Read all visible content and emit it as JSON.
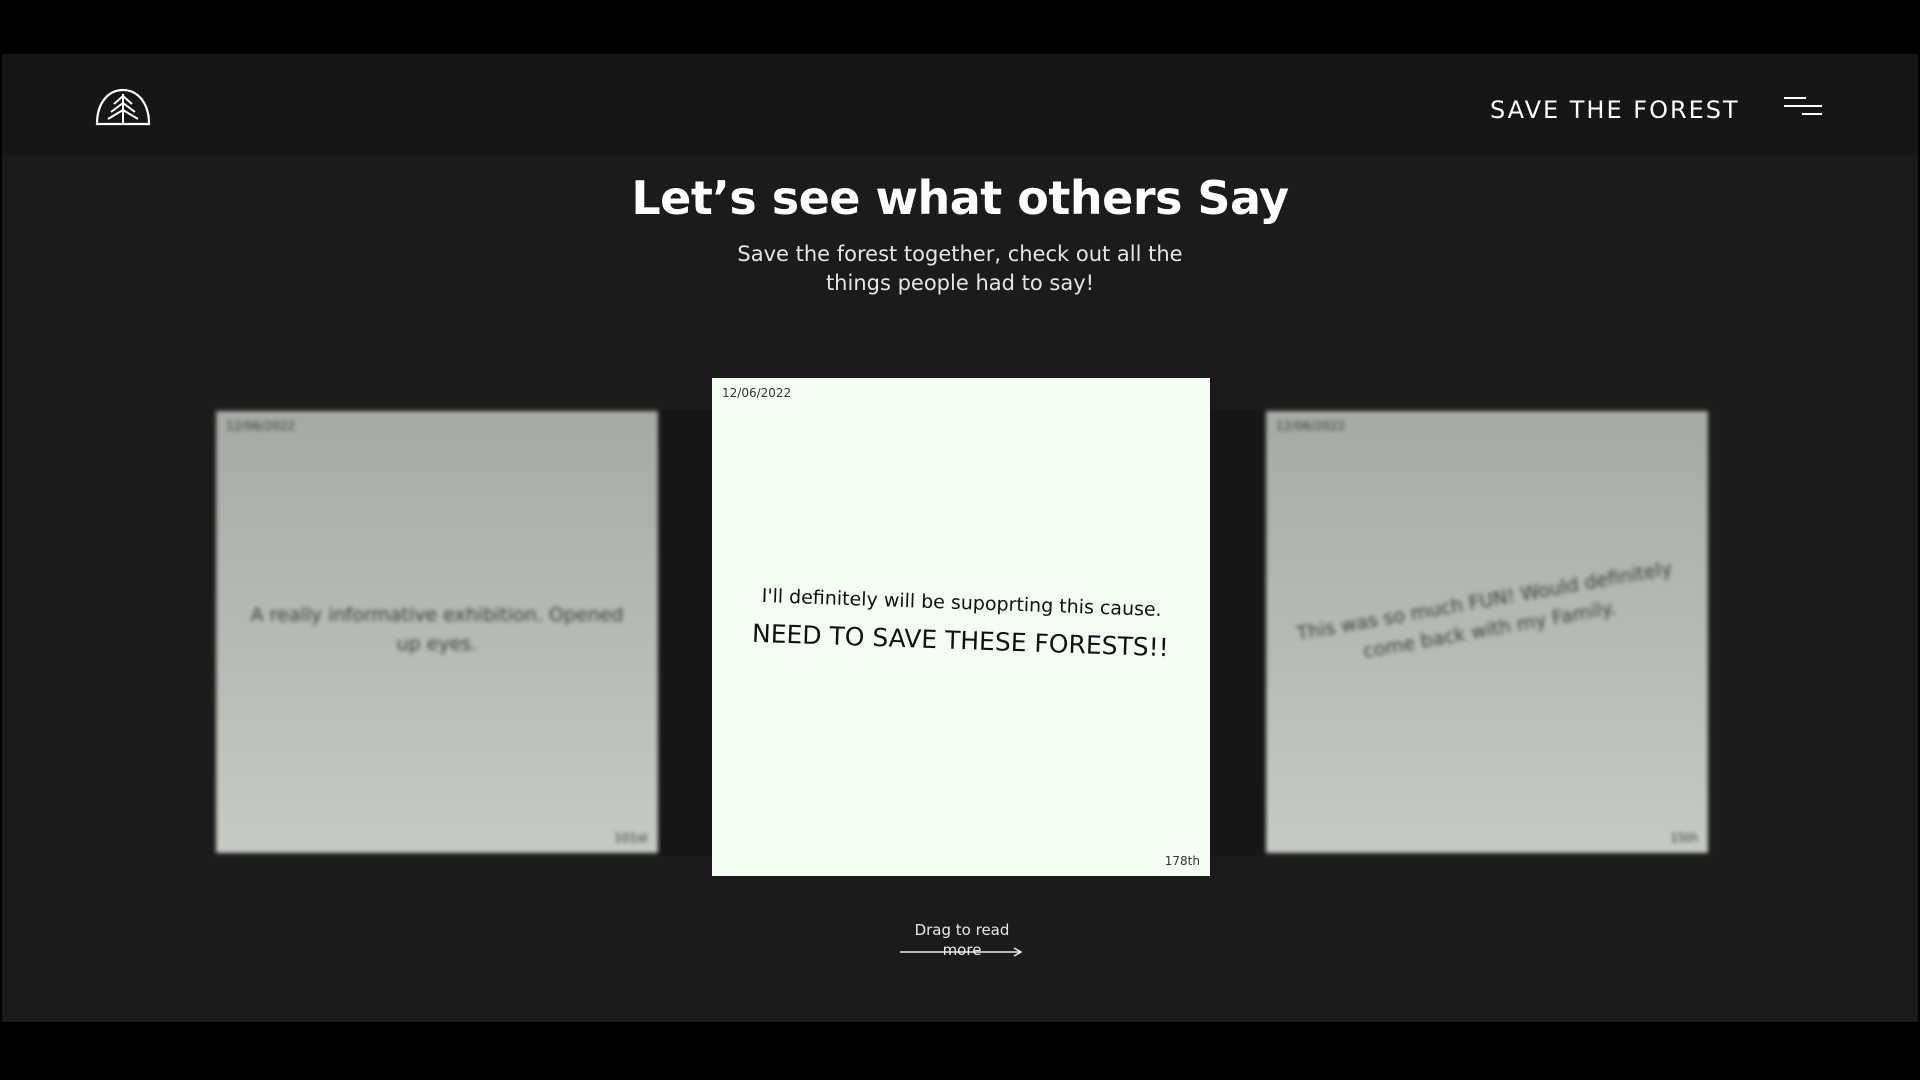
{
  "header": {
    "brand": "SAVE THE FOREST",
    "logo_icon": "tree-dome-icon",
    "menu_icon": "hamburger-menu-icon"
  },
  "section": {
    "title": "Let’s see what others Say",
    "subtitle": "Save the forest together, check out all the things people had to say!"
  },
  "cards": [
    {
      "date": "12/06/2022",
      "message": "A really informative exhibition. Opened up eyes.",
      "rank": "101st"
    },
    {
      "date": "12/06/2022",
      "message_part1": "I'll definitely will be supoprting this cause.",
      "message_part2": "NEED TO SAVE THESE FORESTS!!",
      "rank": "178th"
    },
    {
      "date": "12/06/2022",
      "message": "This was so much FUN! Would definitely come back with my Family.",
      "rank": "15th"
    }
  ],
  "drag_hint": {
    "label": "Drag to read more",
    "icon": "arrow-right-icon"
  },
  "colors": {
    "background": "#1b1b1b",
    "header": "#161616",
    "card_center": "#f4fef3",
    "card_side": "#b6bab4",
    "text": "#ffffff"
  }
}
